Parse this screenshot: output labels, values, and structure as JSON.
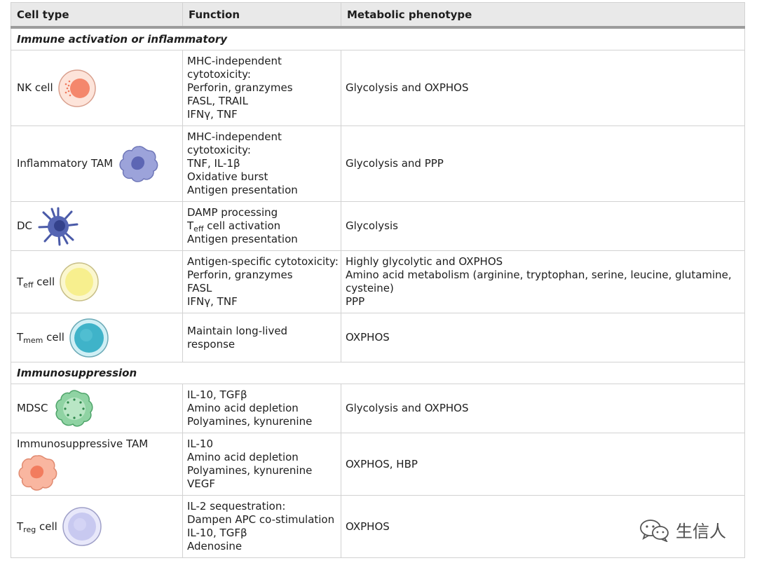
{
  "table": {
    "headers": [
      "Cell type",
      "Function",
      "Metabolic phenotype"
    ],
    "section1": "Immune activation or inflammatory",
    "section2": "Immunosuppression",
    "rows": [
      {
        "cell": "NK cell",
        "cell_main": "",
        "cell_sub": "",
        "cell_suffix": "",
        "icon": "nk-cell-icon",
        "color": "#f4876c",
        "function": [
          "MHC-independent",
          "cytotoxicity:",
          "Perforin, granzymes",
          "FASL, TRAIL",
          "IFNγ, TNF"
        ],
        "metabolic": [
          "Glycolysis and OXPHOS"
        ]
      },
      {
        "cell": "Inflammatory TAM",
        "cell_main": "",
        "cell_sub": "",
        "cell_suffix": "",
        "icon": "inflammatory-tam-icon",
        "color": "#8a92d0",
        "function": [
          "MHC-independent",
          "cytotoxicity:",
          "TNF, IL-1β",
          "Oxidative burst",
          "Antigen presentation"
        ],
        "metabolic": [
          "Glycolysis and PPP"
        ]
      },
      {
        "cell": "DC",
        "cell_main": "",
        "cell_sub": "",
        "cell_suffix": "",
        "icon": "dendritic-cell-icon",
        "color": "#4a5aa8",
        "function_1": "DAMP processing",
        "function_2_main": "T",
        "function_2_sub": "eff",
        "function_2_suffix": " cell activation",
        "function_3": "Antigen presentation",
        "metabolic": [
          "Glycolysis"
        ]
      },
      {
        "cell": "",
        "cell_main": "T",
        "cell_sub": "eff",
        "cell_suffix": " cell",
        "icon": "t-eff-cell-icon",
        "color": "#f7ef8e",
        "function": [
          "Antigen-specific cytotoxicity:",
          "Perforin, granzymes",
          "FASL",
          "IFNγ, TNF"
        ],
        "metabolic": [
          "Highly glycolytic and OXPHOS",
          "Amino acid metabolism (arginine, tryptophan, serine, leucine, glutamine, cysteine)",
          "PPP"
        ]
      },
      {
        "cell": "",
        "cell_main": "T",
        "cell_sub": "mem",
        "cell_suffix": " cell",
        "icon": "t-mem-cell-icon",
        "color": "#3fb3c9",
        "function": [
          "Maintain long-lived",
          "response"
        ],
        "metabolic": [
          "OXPHOS"
        ]
      },
      {
        "cell": "MDSC",
        "cell_main": "",
        "cell_sub": "",
        "cell_suffix": "",
        "icon": "mdsc-icon",
        "color": "#6cc08a",
        "function": [
          "IL-10, TGFβ",
          "Amino acid depletion",
          "Polyamines, kynurenine"
        ],
        "metabolic": [
          "Glycolysis and OXPHOS"
        ]
      },
      {
        "cell": "Immunosuppressive TAM",
        "cell_main": "",
        "cell_sub": "",
        "cell_suffix": "",
        "icon": "immunosuppressive-tam-icon",
        "color": "#f59a80",
        "function": [
          "IL-10",
          "Amino acid depletion",
          "Polyamines, kynurenine",
          "VEGF"
        ],
        "metabolic": [
          "OXPHOS, HBP"
        ]
      },
      {
        "cell": "",
        "cell_main": "T",
        "cell_sub": "reg",
        "cell_suffix": " cell",
        "icon": "t-reg-cell-icon",
        "color": "#c8c9f0",
        "function": [
          "IL-2 sequestration:",
          "Dampen APC co-stimulation",
          "IL-10, TGFβ",
          "Adenosine"
        ],
        "metabolic": [
          "OXPHOS"
        ]
      }
    ]
  },
  "watermark": {
    "text": "生信人",
    "icon": "wechat-icon"
  }
}
